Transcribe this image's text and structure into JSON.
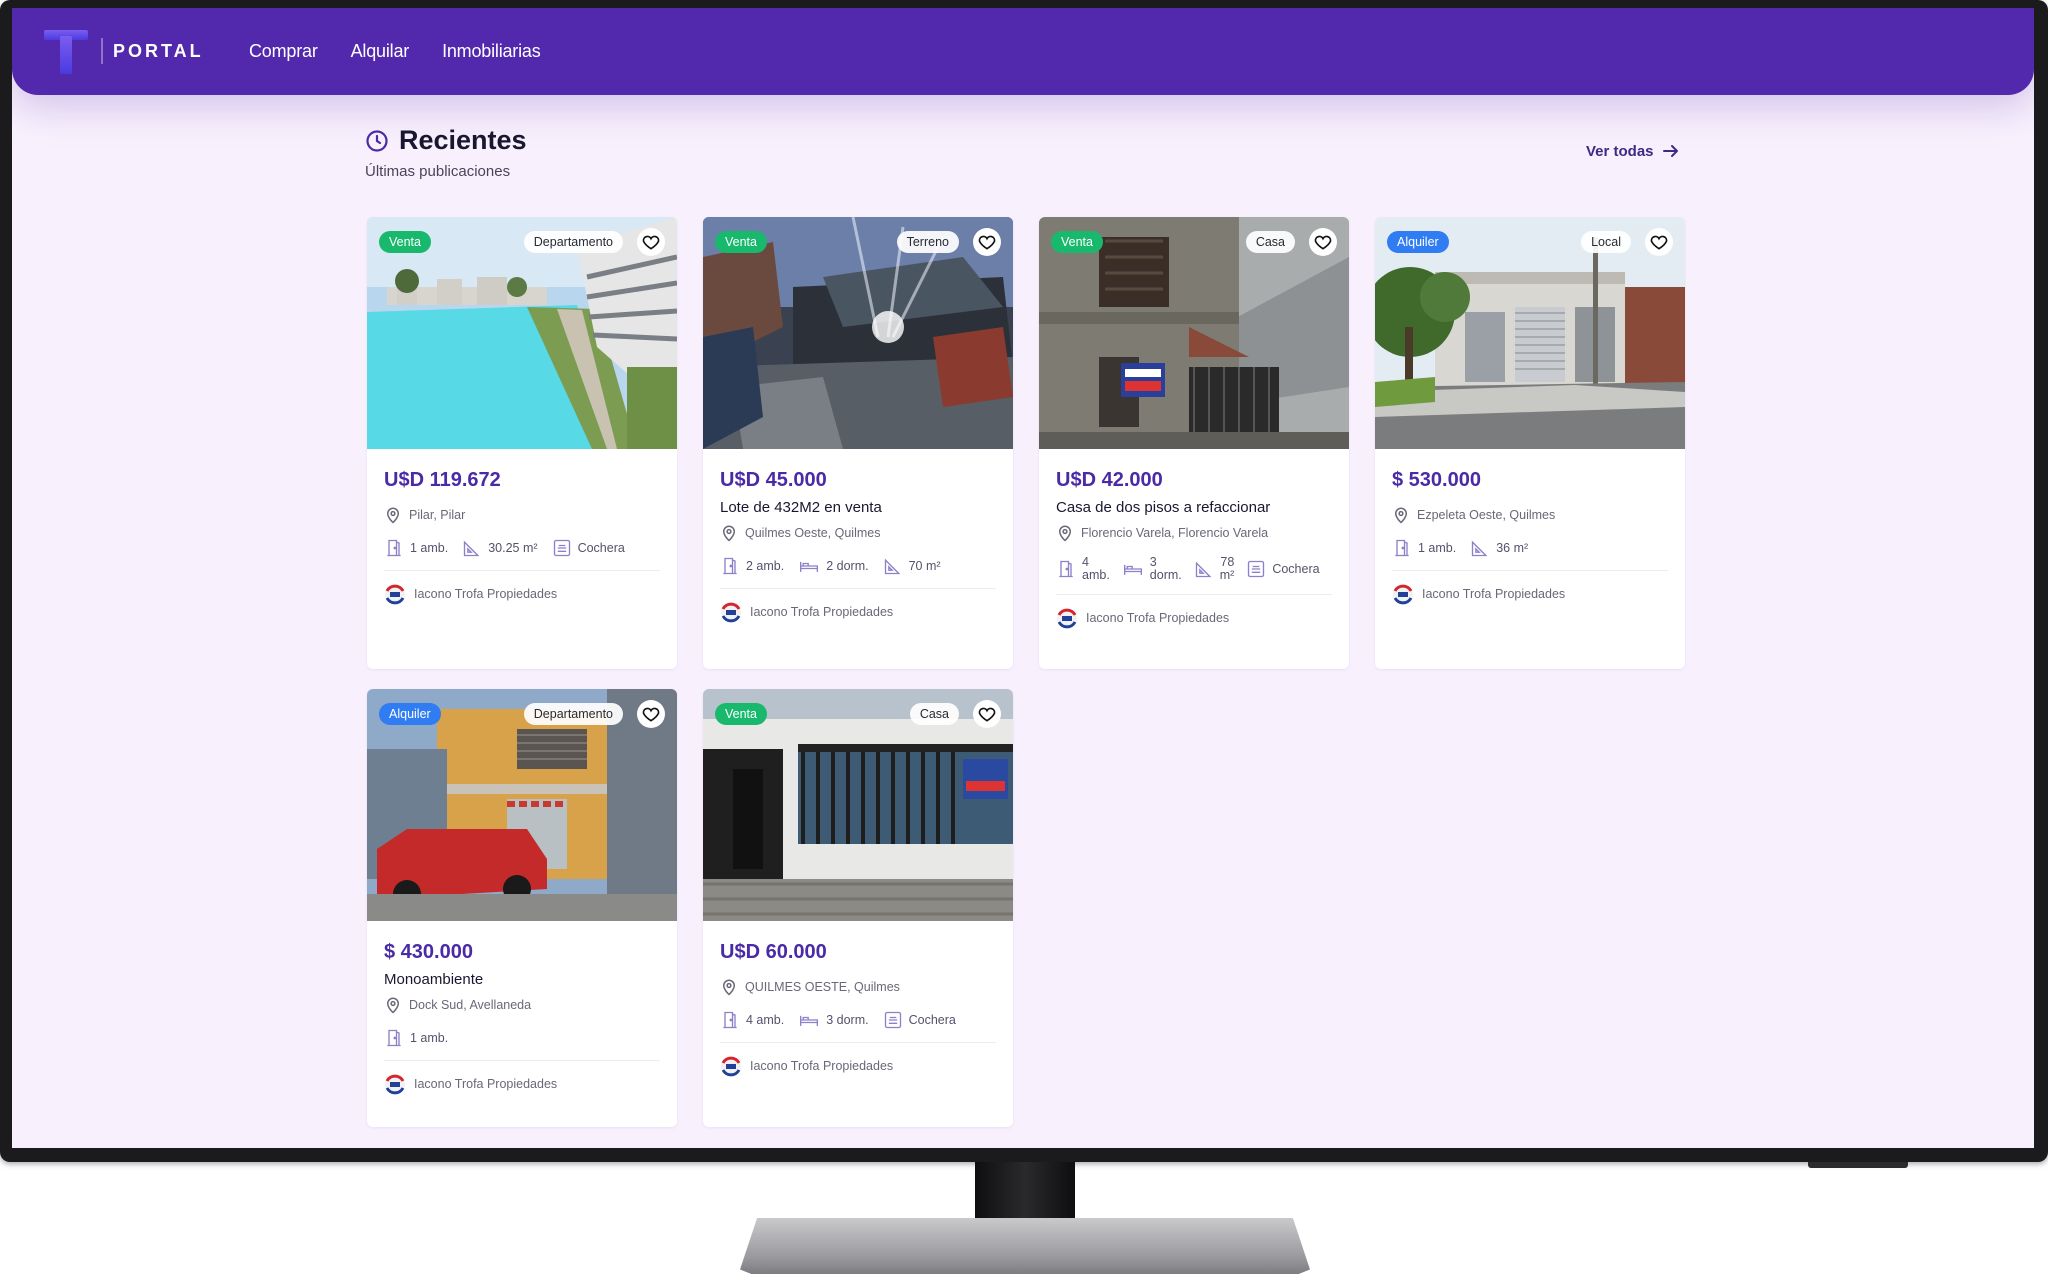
{
  "nav": {
    "brand": "PORTAL",
    "links": [
      "Comprar",
      "Alquilar",
      "Inmobiliarias"
    ]
  },
  "section": {
    "title": "Recientes",
    "subtitle": "Últimas publicaciones",
    "see_all": "Ver todas"
  },
  "colors": {
    "brand_purple": "#5228ad",
    "price_purple": "#4a2aa6",
    "sale_green": "#19b96d",
    "rent_blue": "#2f7cf3",
    "page_bg": "#f8f1fd"
  },
  "listings": [
    {
      "operation": "Venta",
      "type": "Departamento",
      "price": "U$D 119.672",
      "title": "",
      "location": "Pilar, Pilar",
      "features": [
        {
          "icon": "door-icon",
          "label": "1 amb."
        },
        {
          "icon": "area-icon",
          "label": "30.25 m²"
        },
        {
          "icon": "garage-icon",
          "label": "Cochera"
        }
      ],
      "agency": "Iacono Trofa Propiedades"
    },
    {
      "operation": "Venta",
      "type": "Terreno",
      "price": "U$D 45.000",
      "title": "Lote de 432M2 en venta",
      "location": "Quilmes Oeste, Quilmes",
      "features": [
        {
          "icon": "door-icon",
          "label": "2 amb."
        },
        {
          "icon": "bed-icon",
          "label": "2 dorm."
        },
        {
          "icon": "area-icon",
          "label": "70 m²"
        }
      ],
      "agency": "Iacono Trofa Propiedades"
    },
    {
      "operation": "Venta",
      "type": "Casa",
      "price": "U$D 42.000",
      "title": "Casa de dos pisos a refaccionar",
      "location": "Florencio Varela, Florencio Varela",
      "features": [
        {
          "icon": "door-icon",
          "label_top": "4",
          "label_bottom": "amb."
        },
        {
          "icon": "bed-icon",
          "label_top": "3",
          "label_bottom": "dorm."
        },
        {
          "icon": "area-icon",
          "label_top": "78",
          "label_bottom": "m²"
        },
        {
          "icon": "garage-icon",
          "label": "Cochera"
        }
      ],
      "agency": "Iacono Trofa Propiedades"
    },
    {
      "operation": "Alquiler",
      "type": "Local",
      "price": "$ 530.000",
      "title": "",
      "location": "Ezpeleta Oeste, Quilmes",
      "features": [
        {
          "icon": "door-icon",
          "label": "1 amb."
        },
        {
          "icon": "area-icon",
          "label": "36 m²"
        }
      ],
      "agency": "Iacono Trofa Propiedades"
    },
    {
      "operation": "Alquiler",
      "type": "Departamento",
      "price": "$ 430.000",
      "title": "Monoambiente",
      "location": "Dock Sud, Avellaneda",
      "features": [
        {
          "icon": "door-icon",
          "label": "1 amb."
        }
      ],
      "agency": "Iacono Trofa Propiedades"
    },
    {
      "operation": "Venta",
      "type": "Casa",
      "price": "U$D 60.000",
      "title": "",
      "location": "QUILMES OESTE, Quilmes",
      "features": [
        {
          "icon": "door-icon",
          "label": "4 amb."
        },
        {
          "icon": "bed-icon",
          "label": "3 dorm."
        },
        {
          "icon": "garage-icon",
          "label": "Cochera"
        }
      ],
      "agency": "Iacono Trofa Propiedades"
    }
  ]
}
